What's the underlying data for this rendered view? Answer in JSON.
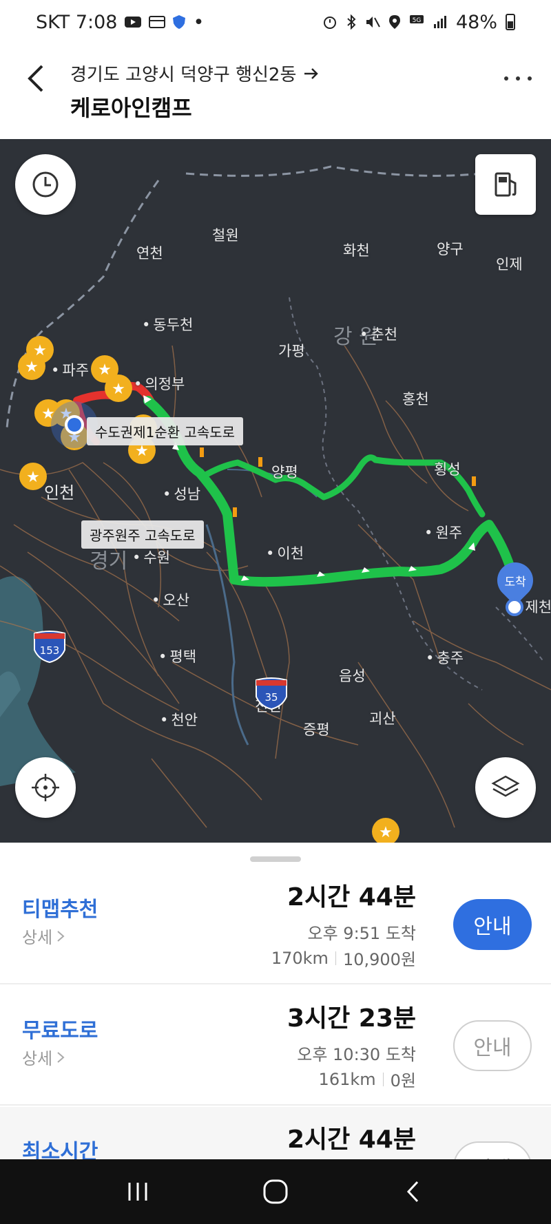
{
  "status_bar": {
    "carrier_time": "SKT 7:08",
    "battery": "48%",
    "icons": [
      "youtube-icon",
      "wallet-icon",
      "shield-icon",
      "alarm-icon",
      "bluetooth-icon",
      "mute-icon",
      "location-icon",
      "5g-icon",
      "signal-icon",
      "battery-icon"
    ]
  },
  "header": {
    "origin": "경기도 고양시 덕양구 행신2동",
    "destination": "케로아인캠프"
  },
  "map": {
    "labels": {
      "cheorwon": "철원",
      "yeoncheon": "연천",
      "hwacheon": "화천",
      "yanggu": "양구",
      "inje": "인제",
      "dongducheon": "동두천",
      "gangwon": "강 원",
      "chuncheon": "춘천",
      "gapyeong": "가평",
      "paju": "파주",
      "uijeongbu": "의정부",
      "hongcheon": "홍천",
      "yangpyeong": "양평",
      "hoengseong": "횡성",
      "incheon": "인천",
      "seongnam": "성남",
      "wonju": "원주",
      "suwon": "수원",
      "icheon": "이천",
      "jecheon": "제천",
      "gyeonggi": "경기",
      "osan": "오산",
      "pyeongtaek": "평택",
      "chungju": "충주",
      "eumseong": "음성",
      "jincheon": "진천",
      "cheonan": "천안",
      "jeungpyeong": "증평",
      "goesan": "괴산"
    },
    "road_tags": {
      "ring_expressway": "수도권제1순환 고속도로",
      "gwangju_wonju_expressway": "광주원주 고속도로"
    },
    "highway_shields": [
      "153",
      "35"
    ],
    "arrive_label": "도착"
  },
  "routes": [
    {
      "name": "티맵추천",
      "detail": "상세",
      "duration": "2시간 44분",
      "arrival": "오후 9:51 도착",
      "distance": "170km",
      "toll": "10,900원",
      "button": "안내",
      "selected": true
    },
    {
      "name": "무료도로",
      "detail": "상세",
      "duration": "3시간 23분",
      "arrival": "오후 10:30 도착",
      "distance": "161km",
      "toll": "0원",
      "button": "안내",
      "selected": false
    },
    {
      "name": "최소시간",
      "duration": "2시간 44분",
      "button": "안내",
      "selected": false
    }
  ],
  "colors": {
    "accent": "#2f6fe0",
    "route": "#1fc24a",
    "traffic_red": "#e5322d"
  }
}
